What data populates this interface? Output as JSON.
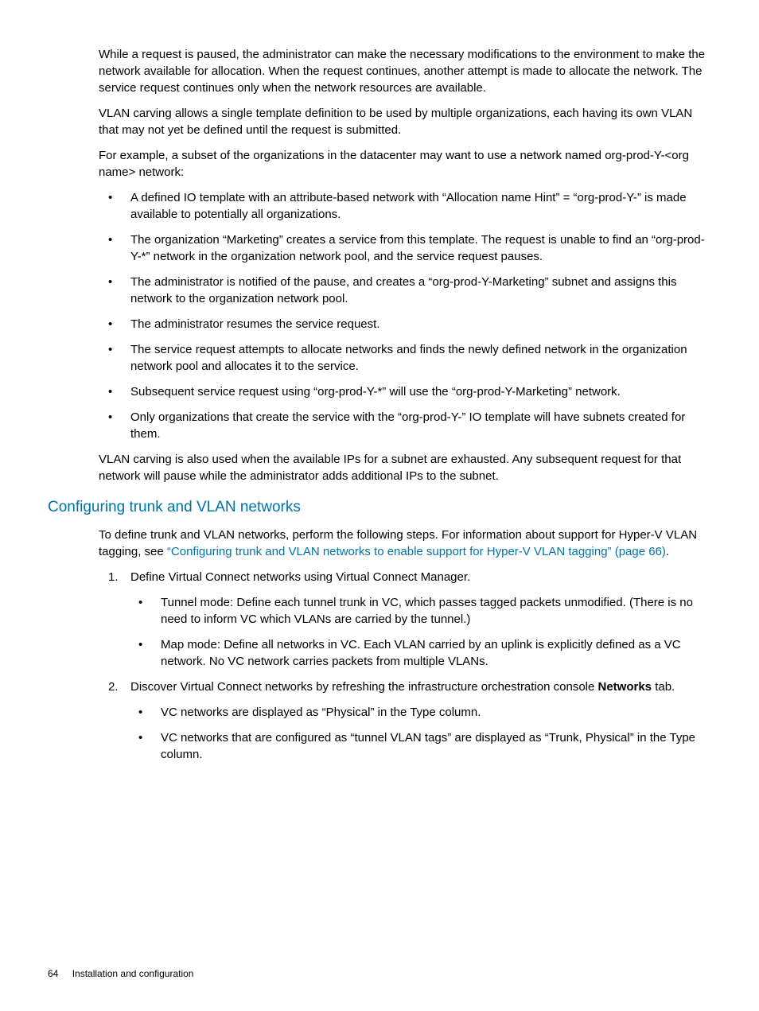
{
  "para1": "While a request is paused, the administrator can make the necessary modifications to the environment to make the network available for allocation. When the request continues, another attempt is made to allocate the network. The service request continues only when the network resources are available.",
  "para2": "VLAN carving allows a single template definition to be used by multiple organizations, each having its own VLAN that may not yet be defined until the request is submitted.",
  "para3": "For example, a subset of the organizations in the datacenter may want to use a network named org-prod-Y-<org name> network:",
  "bullets1": [
    "A defined IO template with an attribute-based network with “Allocation name Hint” = “org-prod-Y-” is made available to potentially all organizations.",
    "The organization “Marketing” creates a service from this template. The request is unable to find an “org-prod-Y-*” network in the organization network pool, and the service request pauses.",
    "The administrator is notified of the pause, and creates a “org-prod-Y-Marketing” subnet and assigns this network to the organization network pool.",
    "The administrator resumes the service request.",
    "The service request attempts to allocate networks and finds the newly defined network in the organization network pool and allocates it to the service.",
    "Subsequent service request using “org-prod-Y-*” will use the “org-prod-Y-Marketing” network.",
    "Only organizations that create the service with the “org-prod-Y-” IO template will have subnets created for them."
  ],
  "para4": "VLAN carving is also used when the available IPs for a subnet are exhausted. Any subsequent request for that network will pause while the administrator adds additional IPs to the subnet.",
  "heading2": "Configuring trunk and VLAN networks",
  "para5_pre": "To define trunk and VLAN networks, perform the following steps. For information about support for Hyper-V VLAN tagging, see ",
  "para5_link": "“Configuring trunk and VLAN networks to enable support for Hyper-V VLAN tagging” (page 66)",
  "para5_post": ".",
  "step1_num": "1.",
  "step1_text": "Define Virtual Connect networks using Virtual Connect Manager.",
  "step1_sub": [
    "Tunnel mode: Define each tunnel trunk in VC, which passes tagged packets unmodified. (There is no need to inform VC which VLANs are carried by the tunnel.)",
    "Map mode: Define all networks in VC. Each VLAN carried by an uplink is explicitly defined as a VC network. No VC network carries packets from multiple VLANs."
  ],
  "step2_num": "2.",
  "step2_pre": "Discover Virtual Connect networks by refreshing the infrastructure orchestration console ",
  "step2_bold": "Networks",
  "step2_post": " tab.",
  "step2_sub": [
    "VC networks are displayed as “Physical” in the Type column.",
    "VC networks that are configured as “tunnel VLAN tags” are displayed as “Trunk, Physical” in the Type column."
  ],
  "footer_page": "64",
  "footer_text": "Installation and configuration"
}
